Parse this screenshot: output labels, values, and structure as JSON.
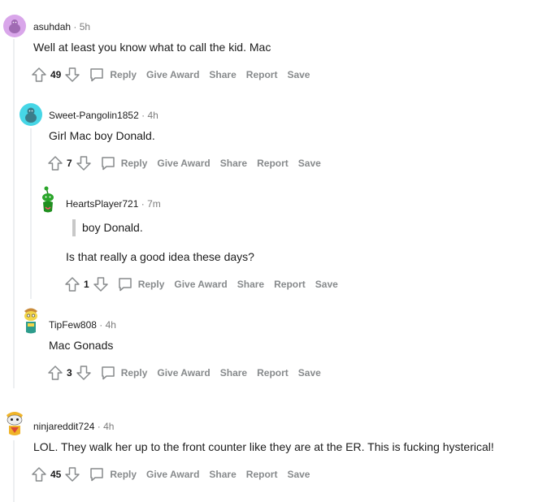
{
  "actions": {
    "reply": "Reply",
    "give_award": "Give Award",
    "share": "Share",
    "report": "Report",
    "save": "Save"
  },
  "separator": "·",
  "comments": [
    {
      "author": "asuhdah",
      "time": "5h",
      "body": "Well at least you know what to call the kid. Mac",
      "score": "49"
    },
    {
      "author": "Sweet-Pangolin1852",
      "time": "4h",
      "body": "Girl Mac boy Donald.",
      "score": "7"
    },
    {
      "author": "HeartsPlayer721",
      "time": "7m",
      "quote": "boy Donald.",
      "body": "Is that really a good idea these days?",
      "score": "1"
    },
    {
      "author": "TipFew808",
      "time": "4h",
      "body": "Mac Gonads",
      "score": "3"
    },
    {
      "author": "ninjareddit724",
      "time": "4h",
      "body": "LOL. They walk her up to the front counter like they are at the ER. This is fucking hysterical!",
      "score": "45"
    }
  ]
}
